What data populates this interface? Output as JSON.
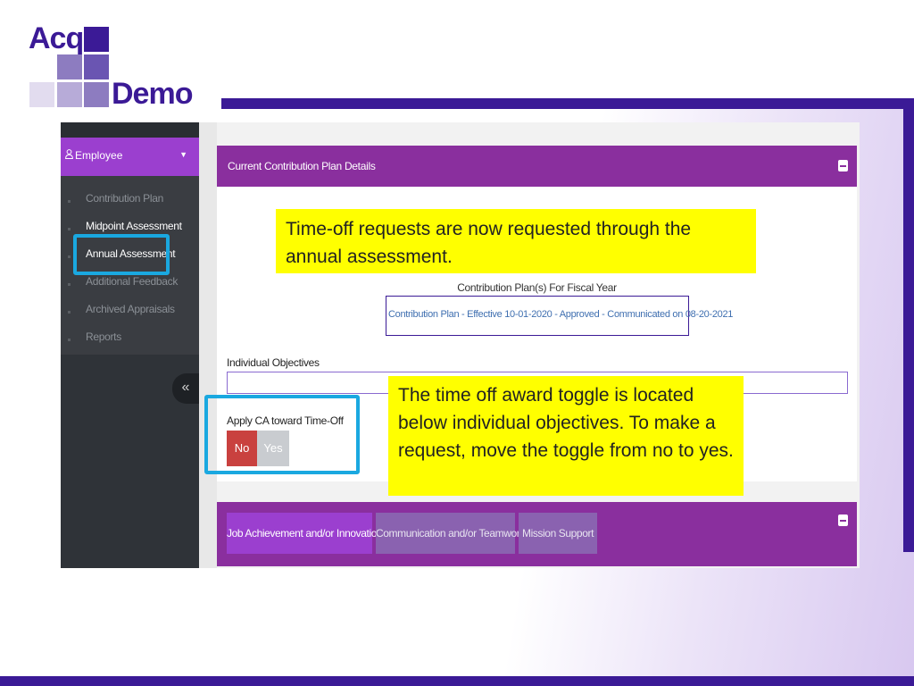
{
  "logo": {
    "line1": "Acq",
    "line2": "Demo"
  },
  "colors": {
    "brand": "#3b1a96",
    "panel": "#8a2f9e",
    "sidebar_active": "#9b3fcf",
    "callout": "#ffff00",
    "highlight": "#1aa8e0"
  },
  "sidebar": {
    "section": "Employee",
    "items": [
      {
        "label": "Contribution Plan"
      },
      {
        "label": "Midpoint Assessment"
      },
      {
        "label": "Annual Assessment"
      },
      {
        "label": "Additional Feedback"
      },
      {
        "label": "Archived Appraisals"
      },
      {
        "label": "Reports"
      }
    ],
    "collapse_glyph": "«"
  },
  "panel": {
    "title": "Current Contribution Plan Details",
    "fiscal_year_label": "Contribution Plan(s) For Fiscal Year",
    "plan_link": "Contribution Plan - Effective 10-01-2020 - Approved - Communicated on 08-20-2021",
    "objectives_label": "Individual Objectives",
    "ca_label": "Apply CA toward Time-Off",
    "toggle": {
      "no": "No",
      "yes": "Yes",
      "selected": "No"
    }
  },
  "tabs": [
    {
      "label": "Job Achievement and/or Innovation"
    },
    {
      "label": "Communication and/or Teamwork"
    },
    {
      "label": "Mission Support"
    }
  ],
  "callouts": {
    "first": "Time-off requests are now requested through the annual assessment.",
    "second": "The time off award toggle is located below individual objectives. To make a request, move the toggle from no to yes."
  }
}
